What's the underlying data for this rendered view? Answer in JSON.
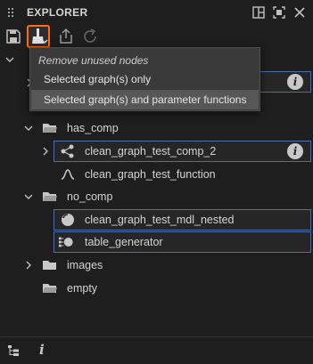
{
  "header": {
    "title": "EXPLORER"
  },
  "menu": {
    "heading": "Remove unused nodes",
    "items": [
      {
        "label": "Selected graph(s) only"
      },
      {
        "label": "Selected graph(s) and parameter functions"
      }
    ]
  },
  "tree": {
    "rows": [
      {
        "label": "has_comp"
      },
      {
        "label": "clean_graph_test_comp_2"
      },
      {
        "label": "clean_graph_test_function"
      },
      {
        "label": "no_comp"
      },
      {
        "label": "clean_graph_test_mdl_nested"
      },
      {
        "label": "table_generator"
      },
      {
        "label": "images"
      },
      {
        "label": "empty"
      }
    ]
  },
  "bottom": {
    "info_glyph": "i"
  },
  "colors": {
    "accent": "#ff6a13",
    "selection_border": "#4b6ea8",
    "background": "#1e1e1e"
  }
}
